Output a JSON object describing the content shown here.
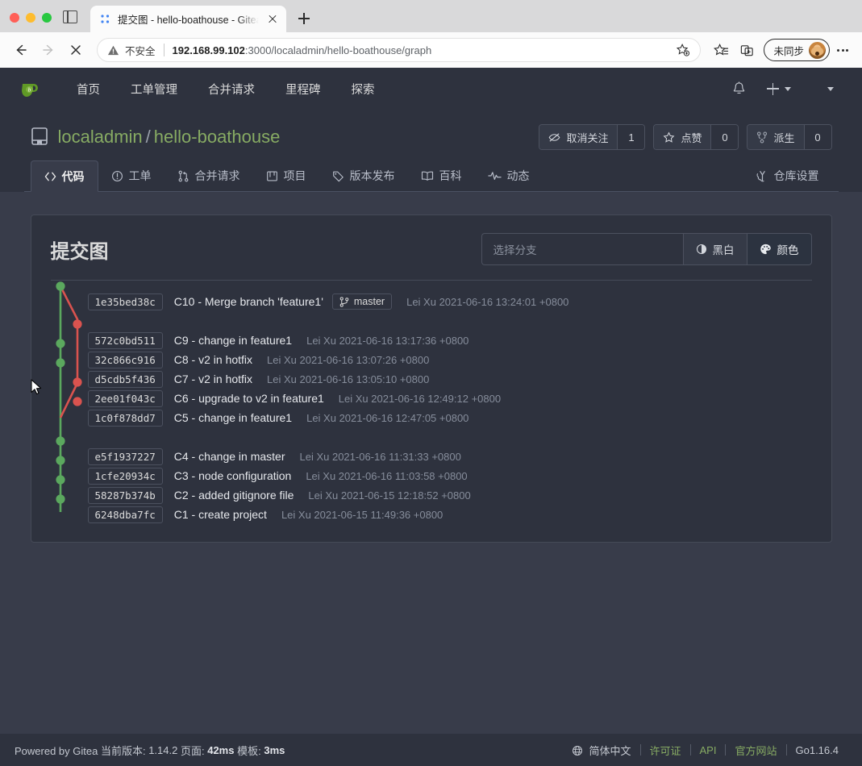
{
  "browser": {
    "tab_title": "提交图 - hello-boathouse - Gitea",
    "security_label": "不安全",
    "url_host": "192.168.99.102",
    "url_rest": ":3000/localadmin/hello-boathouse/graph",
    "profile_label": "未同步",
    "icons": {
      "back": "back-arrow-icon",
      "forward": "forward-arrow-icon",
      "stop": "stop-x-icon",
      "favorite": "star-add-icon",
      "collections": "star-list-icon",
      "split": "split-screen-icon",
      "more": "more-options-icon",
      "newtab": "new-tab-icon"
    }
  },
  "gitea_nav": {
    "logo": "gitea-logo-icon",
    "items": [
      {
        "label": "首页"
      },
      {
        "label": "工单管理"
      },
      {
        "label": "合并请求"
      },
      {
        "label": "里程碑"
      },
      {
        "label": "探索"
      }
    ],
    "bell": "bell-icon",
    "plus": "plus-icon"
  },
  "repo": {
    "owner": "localadmin",
    "separator": "/",
    "name": "hello-boathouse",
    "actions": [
      {
        "name": "watch",
        "label": "取消关注",
        "count": "1",
        "icon": "eye-slash-icon"
      },
      {
        "name": "star",
        "label": "点赞",
        "count": "0",
        "icon": "star-icon"
      },
      {
        "name": "fork",
        "label": "派生",
        "count": "0",
        "icon": "fork-icon"
      }
    ],
    "tabs": [
      {
        "label": "代码",
        "icon": "code-icon",
        "active": true
      },
      {
        "label": "工单",
        "icon": "issue-icon",
        "active": false
      },
      {
        "label": "合并请求",
        "icon": "pull-request-icon",
        "active": false
      },
      {
        "label": "项目",
        "icon": "project-board-icon",
        "active": false
      },
      {
        "label": "版本发布",
        "icon": "tag-icon",
        "active": false
      },
      {
        "label": "百科",
        "icon": "book-icon",
        "active": false
      },
      {
        "label": "动态",
        "icon": "pulse-icon",
        "active": false
      }
    ],
    "settings_tab": {
      "label": "仓库设置",
      "icon": "wrench-icon"
    }
  },
  "graph_panel": {
    "title": "提交图",
    "branch_placeholder": "选择分支",
    "mode_mono": {
      "label": "黑白",
      "icon": "contrast-icon"
    },
    "mode_color": {
      "label": "颜色",
      "icon": "palette-icon"
    },
    "colors": {
      "green": "#5ba85e",
      "red": "#d9534f",
      "accent": "#87ab63"
    },
    "commits": [
      {
        "sha": "1e35bed38c",
        "subject": "C10 - Merge branch 'feature1'",
        "badge": "master",
        "badge_icon": "branch-icon",
        "meta": "Lei Xu 2021-06-16 13:24:01 +0800",
        "lane": "green"
      },
      {
        "sha": "572c0bd511",
        "subject": "C9 - change in feature1",
        "badge": "",
        "meta": "Lei Xu 2021-06-16 13:17:36 +0800",
        "lane": "red"
      },
      {
        "sha": "32c866c916",
        "subject": "C8 - v2 in hotfix",
        "badge": "",
        "meta": "Lei Xu 2021-06-16 13:07:26 +0800",
        "lane": "green"
      },
      {
        "sha": "d5cdb5f436",
        "subject": "C7 - v2 in hotfix",
        "badge": "",
        "meta": "Lei Xu 2021-06-16 13:05:10 +0800",
        "lane": "green"
      },
      {
        "sha": "2ee01f043c",
        "subject": "C6 - upgrade to v2 in feature1",
        "badge": "",
        "meta": "Lei Xu 2021-06-16 12:49:12 +0800",
        "lane": "red"
      },
      {
        "sha": "1c0f878dd7",
        "subject": "C5 - change in feature1",
        "badge": "",
        "meta": "Lei Xu 2021-06-16 12:47:05 +0800",
        "lane": "red"
      },
      {
        "sha": "e5f1937227",
        "subject": "C4 - change in master",
        "badge": "",
        "meta": "Lei Xu 2021-06-16 11:31:33 +0800",
        "lane": "green"
      },
      {
        "sha": "1cfe20934c",
        "subject": "C3 - node configuration",
        "badge": "",
        "meta": "Lei Xu 2021-06-16 11:03:58 +0800",
        "lane": "green"
      },
      {
        "sha": "58287b374b",
        "subject": "C2 - added gitignore file",
        "badge": "",
        "meta": "Lei Xu 2021-06-15 12:18:52 +0800",
        "lane": "green"
      },
      {
        "sha": "6248dba7fc",
        "subject": "C1 - create project",
        "badge": "",
        "meta": "Lei Xu 2021-06-15 11:49:36 +0800",
        "lane": "green"
      }
    ]
  },
  "footer": {
    "powered": "Powered by Gitea 当前版本:",
    "version": "1.14.2",
    "page_label": "页面:",
    "page_time": "42ms",
    "tpl_label": "模板:",
    "tpl_time": "3ms",
    "language": "简体中文",
    "links": [
      {
        "label": "许可证",
        "style": "link"
      },
      {
        "label": "API",
        "style": "link"
      },
      {
        "label": "官方网站",
        "style": "link"
      },
      {
        "label": "Go1.16.4",
        "style": "plain"
      }
    ]
  }
}
